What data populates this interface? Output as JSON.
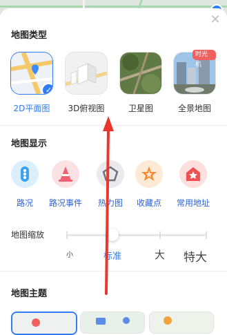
{
  "map_type": {
    "title": "地图类型",
    "options": [
      {
        "label": "2D平面图",
        "selected": true
      },
      {
        "label": "3D俯视图",
        "selected": false
      },
      {
        "label": "卫星图",
        "selected": false
      },
      {
        "label": "全景地图",
        "selected": false,
        "badge": "时光机"
      }
    ]
  },
  "map_display": {
    "title": "地图显示",
    "items": [
      {
        "label": "路况",
        "icon": "traffic-light-icon",
        "color": "#3aa0ef"
      },
      {
        "label": "路况事件",
        "icon": "traffic-cone-icon",
        "color": "#f06070"
      },
      {
        "label": "热力图",
        "icon": "pentagon-icon",
        "color": "#7a7a8a"
      },
      {
        "label": "收藏点",
        "icon": "star-icon",
        "color": "#f28a2a"
      },
      {
        "label": "常用地址",
        "icon": "home-icon",
        "color": "#f05050"
      }
    ]
  },
  "map_zoom": {
    "label": "地图缩放",
    "options": [
      "小",
      "标准",
      "大",
      "特大"
    ],
    "selected": "标准"
  },
  "map_theme": {
    "title": "地图主题"
  },
  "colors": {
    "accent": "#2f7cf6",
    "display_label": "#2f62d6",
    "annotation_arrow": "#e8382e"
  }
}
